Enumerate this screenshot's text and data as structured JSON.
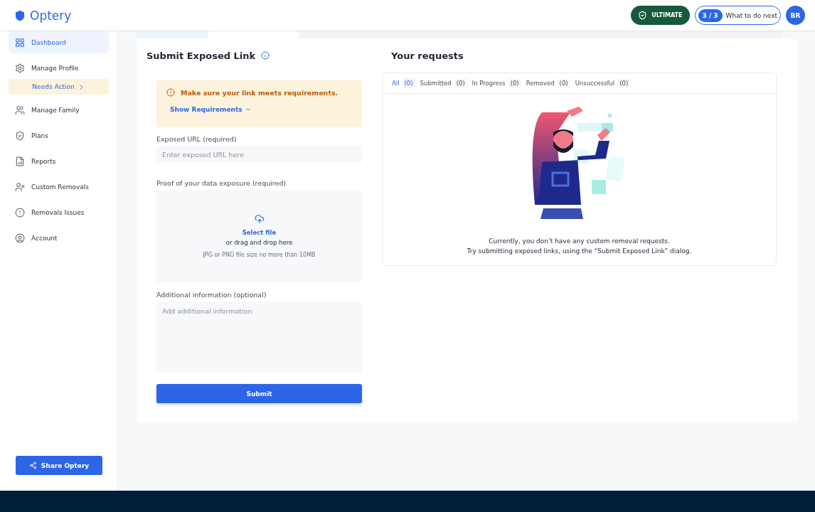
{
  "header": {
    "brand": "Optery",
    "plan_badge": "ULTIMATE",
    "progress": "3 / 3",
    "next_label": "What to do next",
    "avatar": "BR"
  },
  "sidebar": {
    "items": [
      {
        "label": "Dashboard",
        "selected": true
      },
      {
        "label": "Manage Profile",
        "selected": false,
        "notice": "Needs Action"
      },
      {
        "label": "Manage Family",
        "selected": false
      },
      {
        "label": "Plans",
        "selected": false
      },
      {
        "label": "Reports",
        "selected": false
      },
      {
        "label": "Custom Removals",
        "selected": false
      },
      {
        "label": "Removals Issues",
        "selected": false
      },
      {
        "label": "Account",
        "selected": false
      }
    ],
    "share_button": "Share Optery"
  },
  "submit_form": {
    "title": "Submit Exposed Link",
    "warning": "Make sure your link meets requirements.",
    "requirements_link": "Show Requirements",
    "url_label": "Exposed URL (required)",
    "url_placeholder": "Enter exposed URL here",
    "proof_label": "Proof of your data exposure (required)",
    "select_file": "Select file",
    "drag_text": "or drag and drop here",
    "file_hint": "JPG or PNG file size no more than 10MB",
    "info_label": "Additional information (optional)",
    "info_placeholder": "Add additional information",
    "submit": "Submit"
  },
  "requests": {
    "title": "Your requests",
    "tabs": [
      {
        "label": "All",
        "count": "(0)",
        "selected": true
      },
      {
        "label": "Submitted",
        "count": "(0)",
        "selected": false
      },
      {
        "label": "In Progress",
        "count": "(0)",
        "selected": false
      },
      {
        "label": "Removed",
        "count": "(0)",
        "selected": false
      },
      {
        "label": "Unsuccessful",
        "count": "(0)",
        "selected": false
      }
    ],
    "empty_lines": [
      "Currently, you don’t have any custom removal requests.",
      "Try submitting exposed links, using the “Submit Exposed Link” dialog."
    ]
  }
}
